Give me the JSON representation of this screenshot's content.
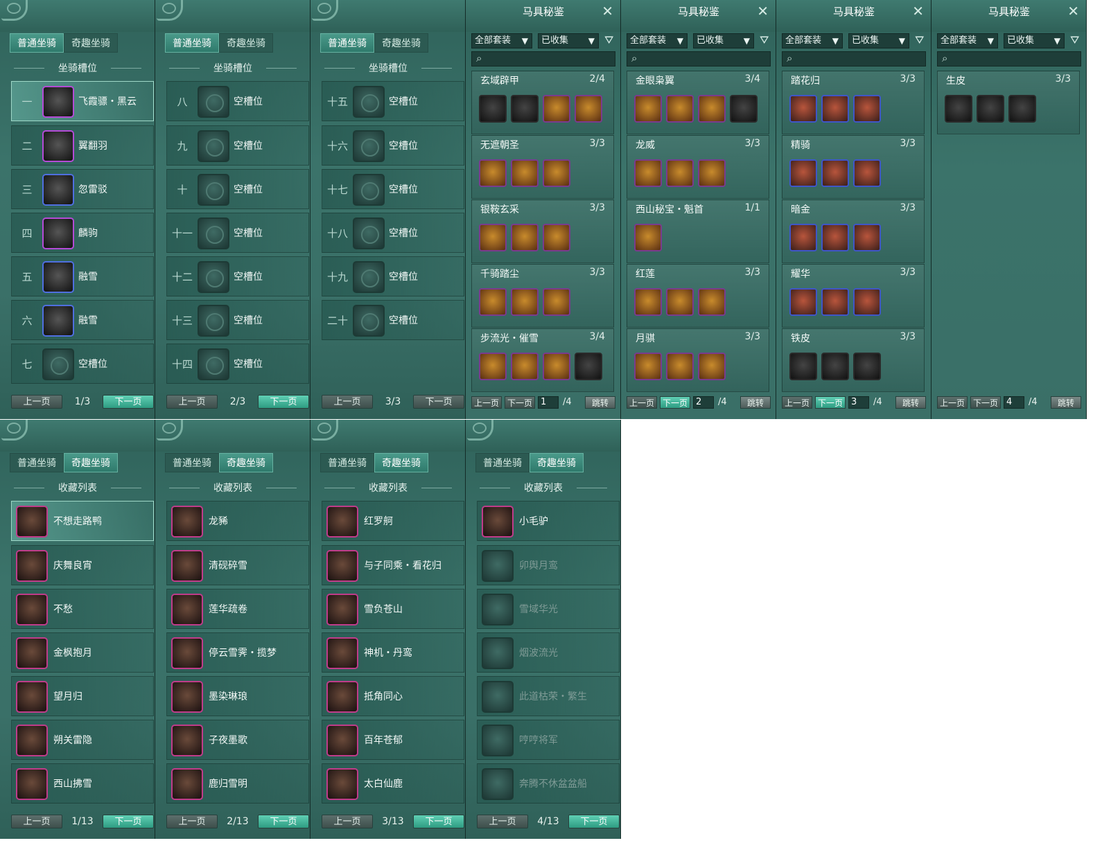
{
  "tabs": {
    "normal": "普通坐骑",
    "fun": "奇趣坐骑"
  },
  "slot_section": "坐骑槽位",
  "collect_section": "收藏列表",
  "prev": "上一页",
  "next": "下一页",
  "empty": "空槽位",
  "slot_pages": [
    {
      "page": "1/3",
      "rows": [
        {
          "num": "一",
          "name": "飞霞骠・黑云"
        },
        {
          "num": "二",
          "name": "翼翻羽"
        },
        {
          "num": "三",
          "name": "忽雷驳"
        },
        {
          "num": "四",
          "name": "麟驹"
        },
        {
          "num": "五",
          "name": "融雪"
        },
        {
          "num": "六",
          "name": "融雪"
        },
        {
          "num": "七",
          "name": "空槽位"
        }
      ]
    },
    {
      "page": "2/3",
      "rows": [
        {
          "num": "八",
          "name": "空槽位"
        },
        {
          "num": "九",
          "name": "空槽位"
        },
        {
          "num": "十",
          "name": "空槽位"
        },
        {
          "num": "十一",
          "name": "空槽位"
        },
        {
          "num": "十二",
          "name": "空槽位"
        },
        {
          "num": "十三",
          "name": "空槽位"
        },
        {
          "num": "十四",
          "name": "空槽位"
        }
      ]
    },
    {
      "page": "3/3",
      "rows": [
        {
          "num": "十五",
          "name": "空槽位"
        },
        {
          "num": "十六",
          "name": "空槽位"
        },
        {
          "num": "十七",
          "name": "空槽位"
        },
        {
          "num": "十八",
          "name": "空槽位"
        },
        {
          "num": "十九",
          "name": "空槽位"
        },
        {
          "num": "二十",
          "name": "空槽位"
        }
      ]
    }
  ],
  "equip": {
    "title": "马具秘鉴",
    "filter_all": "全部套装",
    "filter_collected": "已收集",
    "jump": "跳转",
    "total": "/4",
    "pages": [
      {
        "page": "1",
        "sets": [
          {
            "name": "玄域辟甲",
            "count": "2/4"
          },
          {
            "name": "无遮朝圣",
            "count": "3/3"
          },
          {
            "name": "银鞍玄采",
            "count": "3/3"
          },
          {
            "name": "千骑踏尘",
            "count": "3/3"
          },
          {
            "name": "步流光・催雪",
            "count": "3/4"
          }
        ]
      },
      {
        "page": "2",
        "sets": [
          {
            "name": "金眼枭翼",
            "count": "3/4"
          },
          {
            "name": "龙威",
            "count": "3/3"
          },
          {
            "name": "西山秘宝・魁首",
            "count": "1/1"
          },
          {
            "name": "红莲",
            "count": "3/3"
          },
          {
            "name": "月骐",
            "count": "3/3"
          }
        ]
      },
      {
        "page": "3",
        "sets": [
          {
            "name": "踏花归",
            "count": "3/3"
          },
          {
            "name": "精骑",
            "count": "3/3"
          },
          {
            "name": "暗金",
            "count": "3/3"
          },
          {
            "name": "耀华",
            "count": "3/3"
          },
          {
            "name": "铁皮",
            "count": "3/3"
          }
        ]
      },
      {
        "page": "4",
        "sets": [
          {
            "name": "生皮",
            "count": "3/3"
          }
        ]
      }
    ]
  },
  "fun_pages": [
    {
      "page": "1/13",
      "rows": [
        "不想走路鸭",
        "庆舞良宵",
        "不愁",
        "金枫抱月",
        "望月归",
        "朔关雷隐",
        "西山拂雪"
      ]
    },
    {
      "page": "2/13",
      "rows": [
        "龙豨",
        "清砚碎雪",
        "莲华疏卷",
        "停云雪霁・揽梦",
        "墨染琳琅",
        "子夜墨歌",
        "鹿归雪明"
      ]
    },
    {
      "page": "3/13",
      "rows": [
        "红罗舸",
        "与子同乘・看花归",
        "雪负苍山",
        "神机・丹鸾",
        "抵角同心",
        "百年苍郁",
        "太白仙鹿"
      ]
    },
    {
      "page": "4/13",
      "rows": [
        "小毛驴",
        "卯舆月鸾",
        "雪域华光",
        "烟波流光",
        "此道枯荣・繁生",
        "哼哼将军",
        "奔腾不休盆盆船"
      ]
    }
  ]
}
